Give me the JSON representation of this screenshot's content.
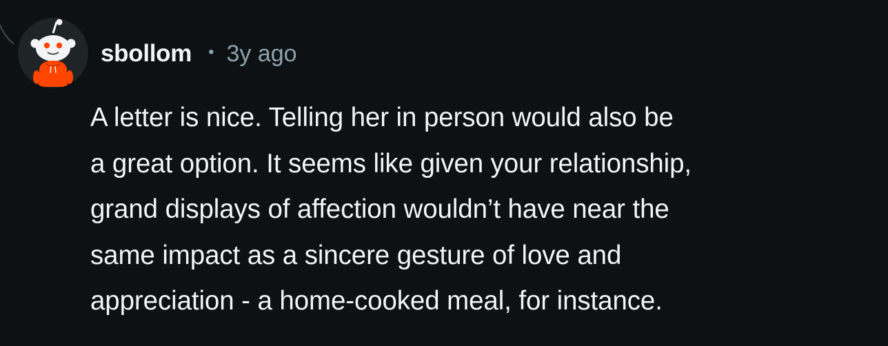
{
  "comment": {
    "username": "sbollom",
    "separator": "•",
    "timestamp": "3y ago",
    "avatar_icon": "snoo-avatar-icon",
    "body_lines": [
      "A letter is nice. Telling her in person would also be",
      "a great option. It seems like given your relationship,",
      "grand displays of affection wouldn’t have near the",
      "same impact as a sincere gesture of love and",
      "appreciation - a home-cooked meal, for instance."
    ]
  },
  "colors": {
    "background": "#0e1113",
    "text": "#f2f4f5",
    "meta": "#8ba2ad",
    "avatar_accent": "#ff4500"
  }
}
